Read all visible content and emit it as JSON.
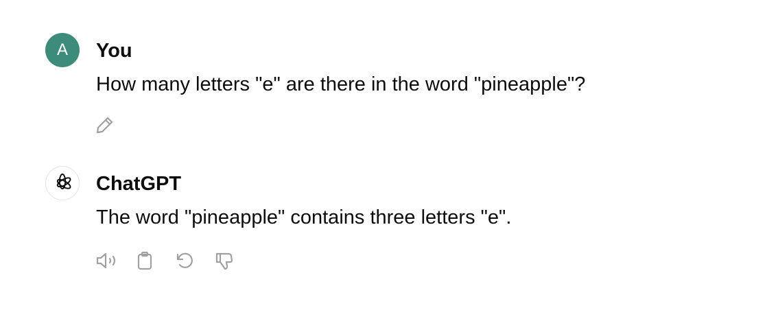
{
  "conversation": {
    "messages": [
      {
        "author": "You",
        "avatar_letter": "A",
        "avatar_color": "#3d8b7a",
        "text": "How many letters \"e\" are there in the word \"pineapple\"?",
        "actions": [
          "edit-icon"
        ]
      },
      {
        "author": "ChatGPT",
        "avatar_icon": "openai-logo-icon",
        "text": "The word \"pineapple\" contains three letters \"e\".",
        "actions": [
          "speaker-icon",
          "clipboard-icon",
          "regenerate-icon",
          "thumbs-down-icon"
        ]
      }
    ]
  },
  "colors": {
    "text": "#0d0d0d",
    "icon": "#a0a0a0",
    "user_avatar": "#3d8b7a"
  }
}
